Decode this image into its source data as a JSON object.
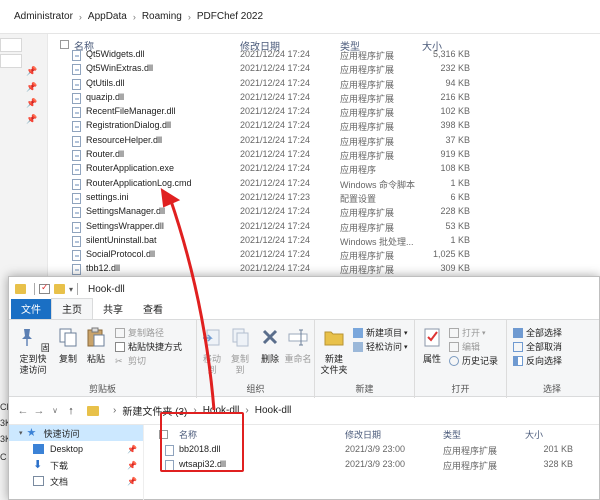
{
  "background_window": {
    "breadcrumb": [
      "Administrator",
      "AppData",
      "Roaming",
      "PDFChef 2022"
    ],
    "columns": {
      "name": "名称",
      "date": "修改日期",
      "type": "类型",
      "size": "大小"
    },
    "files": [
      {
        "name": "Qt5Widgets.dll",
        "date": "2021/12/24 17:24",
        "type": "应用程序扩展",
        "size": "5,316 KB"
      },
      {
        "name": "Qt5WinExtras.dll",
        "date": "2021/12/24 17:24",
        "type": "应用程序扩展",
        "size": "232 KB"
      },
      {
        "name": "QtUtils.dll",
        "date": "2021/12/24 17:24",
        "type": "应用程序扩展",
        "size": "94 KB"
      },
      {
        "name": "quazip.dll",
        "date": "2021/12/24 17:24",
        "type": "应用程序扩展",
        "size": "216 KB"
      },
      {
        "name": "RecentFileManager.dll",
        "date": "2021/12/24 17:24",
        "type": "应用程序扩展",
        "size": "102 KB"
      },
      {
        "name": "RegistrationDialog.dll",
        "date": "2021/12/24 17:24",
        "type": "应用程序扩展",
        "size": "398 KB"
      },
      {
        "name": "ResourceHelper.dll",
        "date": "2021/12/24 17:24",
        "type": "应用程序扩展",
        "size": "37 KB"
      },
      {
        "name": "Router.dll",
        "date": "2021/12/24 17:24",
        "type": "应用程序扩展",
        "size": "919 KB"
      },
      {
        "name": "RouterApplication.exe",
        "date": "2021/12/24 17:24",
        "type": "应用程序",
        "size": "108 KB"
      },
      {
        "name": "RouterApplicationLog.cmd",
        "date": "2021/12/24 17:24",
        "type": "Windows 命令脚本",
        "size": "1 KB"
      },
      {
        "name": "settings.ini",
        "date": "2021/12/24 17:23",
        "type": "配置设置",
        "size": "6 KB"
      },
      {
        "name": "SettingsManager.dll",
        "date": "2021/12/24 17:24",
        "type": "应用程序扩展",
        "size": "228 KB"
      },
      {
        "name": "SettingsWrapper.dll",
        "date": "2021/12/24 17:24",
        "type": "应用程序扩展",
        "size": "53 KB"
      },
      {
        "name": "silentUninstall.bat",
        "date": "2021/12/24 17:24",
        "type": "Windows 批处理...",
        "size": "1 KB"
      },
      {
        "name": "SocialProtocol.dll",
        "date": "2021/12/24 17:24",
        "type": "应用程序扩展",
        "size": "1,025 KB"
      },
      {
        "name": "tbb12.dll",
        "date": "2021/12/24 17:24",
        "type": "应用程序扩展",
        "size": "309 KB"
      }
    ]
  },
  "foreground_window": {
    "title": "Hook-dll",
    "tabs": {
      "file": "文件",
      "home": "主页",
      "share": "共享",
      "view": "查看"
    },
    "ribbon": {
      "clipboard": {
        "label": "剪贴板",
        "pin": "固定到快\n速访问",
        "copy": "复制",
        "paste": "粘贴",
        "copy_path": "复制路径",
        "paste_shortcut": "粘贴快捷方式",
        "cut": "剪切"
      },
      "organize": {
        "label": "组织",
        "move_to": "移动到",
        "copy_to": "复制到",
        "delete": "删除",
        "rename": "重命名"
      },
      "new": {
        "label": "新建",
        "new_folder": "新建\n文件夹",
        "new_item": "新建项目",
        "easy_access": "轻松访问"
      },
      "open": {
        "label": "打开",
        "properties": "属性",
        "open": "打开",
        "edit": "编辑",
        "history": "历史记录"
      },
      "select": {
        "label": "选择",
        "select_all": "全部选择",
        "select_none": "全部取消",
        "invert": "反向选择"
      }
    },
    "address": [
      "新建文件夹 (3)",
      "Hook-dll",
      "Hook-dll"
    ],
    "nav": {
      "quick_access": "快速访问",
      "desktop": "Desktop",
      "downloads": "下载",
      "documents": "文档"
    },
    "columns": {
      "name": "名称",
      "date": "修改日期",
      "type": "类型",
      "size": "大小"
    },
    "files": [
      {
        "name": "bb2018.dll",
        "date": "2021/3/9 23:00",
        "type": "应用程序扩展",
        "size": "201 KB"
      },
      {
        "name": "wtsapi32.dll",
        "date": "2021/3/9 23:00",
        "type": "应用程序扩展",
        "size": "328 KB"
      }
    ]
  },
  "left_edge_fragments": [
    "CL",
    "3K",
    "3K",
    "C"
  ],
  "colors": {
    "accent": "#1a6fc4",
    "highlight": "#e02020",
    "folder": "#e8c14a",
    "selection": "#cce8ff"
  }
}
